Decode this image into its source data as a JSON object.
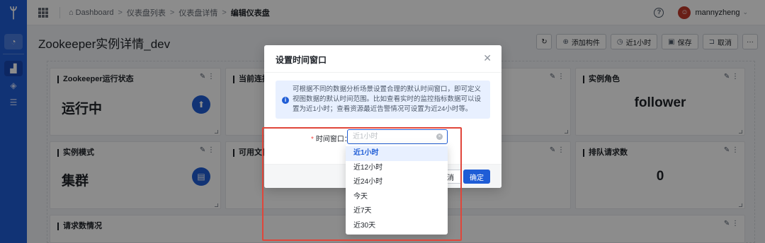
{
  "topbar": {
    "breadcrumbs": [
      "Dashboard",
      "仪表盘列表",
      "仪表盘详情"
    ],
    "current": "编辑仪表盘",
    "separator": ">",
    "username": "mannyzheng"
  },
  "page": {
    "title": "Zookeeper实例详情_dev"
  },
  "toolbar": {
    "add_widget": "添加构件",
    "time_range": "近1小时",
    "save": "保存",
    "cancel": "取消"
  },
  "panels": {
    "run_status_title": "Zookeeper运行状态",
    "run_status_value": "运行中",
    "conn_title": "当前连接",
    "role_title": "实例角色",
    "role_value": "follower",
    "mode_title": "实例模式",
    "mode_value": "集群",
    "avail_title": "可用文件",
    "queue_title": "排队请求数",
    "queue_value": "0",
    "requests_title": "请求数情况"
  },
  "modal": {
    "title": "设置时间窗口",
    "info_text": "可根据不同的数据分析场景设置合理的默认时间窗口，即可定义视图数据的默认时间范围。比如查看实时的监控指标数据可以设置为近1小时；查看资源最近告警情况可设置为近24小时等。",
    "field_label": "时间窗口：",
    "field_placeholder": "近1小时",
    "cancel_label": "取消",
    "ok_label": "确定"
  },
  "dropdown": {
    "options": [
      "近1小时",
      "近12小时",
      "近24小时",
      "今天",
      "近7天",
      "近30天"
    ],
    "selected_index": 0
  },
  "colors": {
    "primary": "#1f5dd6",
    "annotation": "#e0463a"
  }
}
